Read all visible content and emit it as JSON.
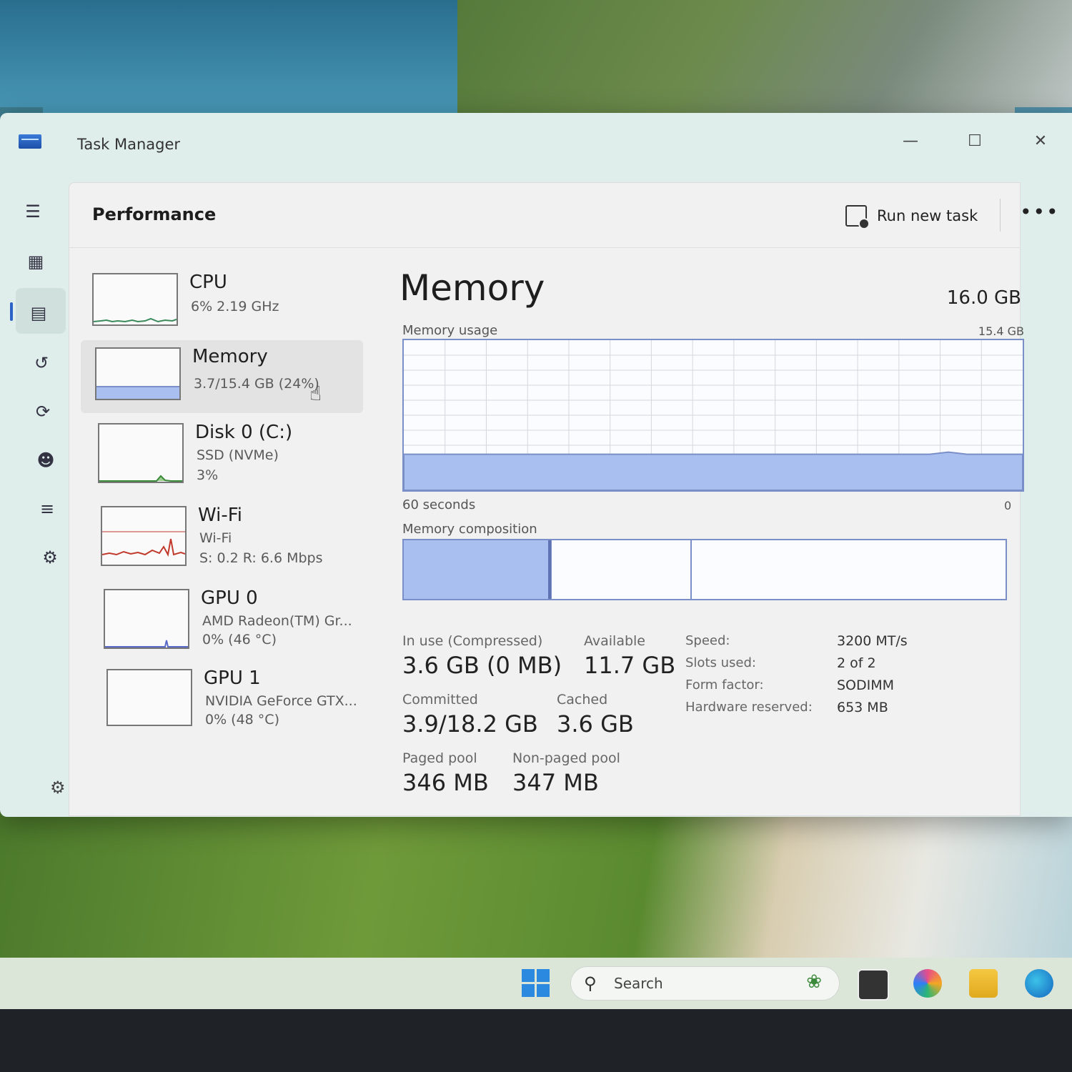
{
  "window": {
    "title": "Task Manager"
  },
  "header": {
    "page_title": "Performance",
    "run_new_task": "Run new task",
    "more": "•••"
  },
  "nav": {
    "items": [
      "menu-icon",
      "processes-icon",
      "performance-icon",
      "app-history-icon",
      "startup-apps-icon",
      "users-icon",
      "details-icon",
      "services-icon",
      "settings-icon"
    ]
  },
  "devices": [
    {
      "name": "CPU",
      "line1": "6%  2.19 GHz",
      "line2": ""
    },
    {
      "name": "Memory",
      "line1": "3.7/15.4 GB (24%)",
      "line2": ""
    },
    {
      "name": "Disk 0 (C:)",
      "line1": "SSD (NVMe)",
      "line2": "3%"
    },
    {
      "name": "Wi-Fi",
      "line1": "Wi-Fi",
      "line2": "S: 0.2  R: 6.6 Mbps"
    },
    {
      "name": "GPU 0",
      "line1": "AMD Radeon(TM) Gr...",
      "line2": "0%  (46 °C)"
    },
    {
      "name": "GPU 1",
      "line1": "NVIDIA GeForce GTX...",
      "line2": "0%  (48 °C)"
    }
  ],
  "detail": {
    "title": "Memory",
    "total": "16.0 GB",
    "usage_label": "Memory usage",
    "usage_max": "15.4 GB",
    "time_left": "60 seconds",
    "time_right": "0",
    "usage_fraction": 0.24,
    "composition_label": "Memory composition",
    "composition": {
      "in_use_fraction": 0.24,
      "modified_fraction": 0.005,
      "standby_fraction": 0.23
    },
    "stats": {
      "in_use_label": "In use (Compressed)",
      "in_use": "3.6 GB (0 MB)",
      "available_label": "Available",
      "available": "11.7 GB",
      "committed_label": "Committed",
      "committed": "3.9/18.2 GB",
      "cached_label": "Cached",
      "cached": "3.6 GB",
      "paged_label": "Paged pool",
      "paged": "346 MB",
      "nonpaged_label": "Non-paged pool",
      "nonpaged": "347 MB"
    },
    "specs": [
      {
        "label": "Speed:",
        "value": "3200 MT/s"
      },
      {
        "label": "Slots used:",
        "value": "2 of 2"
      },
      {
        "label": "Form factor:",
        "value": "SODIMM"
      },
      {
        "label": "Hardware reserved:",
        "value": "653 MB"
      }
    ]
  },
  "taskbar": {
    "search_placeholder": "Search"
  },
  "colors": {
    "accent": "#2a62c8",
    "memory_fill": "#a9bff0",
    "memory_line": "#7a8ec8",
    "wifi_line": "#c0392b"
  }
}
